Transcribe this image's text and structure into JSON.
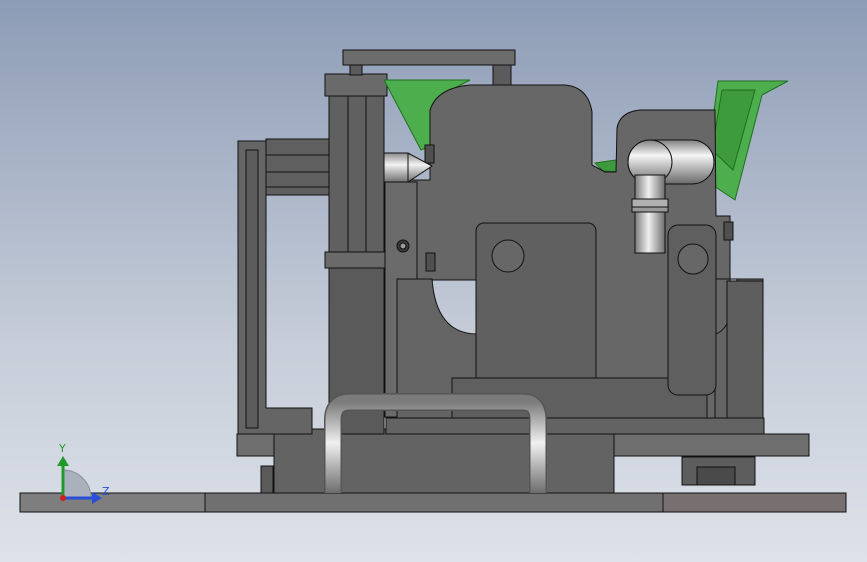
{
  "viewport": {
    "background_top": "#8d9cb6",
    "background_bottom": "#dde2ea"
  },
  "palette": {
    "metal": "#6b6b6b",
    "metal_dark": "#4d4d4d",
    "metal_light": "#8a8a8a",
    "edge": "#111111",
    "green": "#4cae4c",
    "green_dark": "#1f6f1f",
    "chrome": "#c8c8c8"
  },
  "triad": {
    "y_label": "Y",
    "z_label": "Z",
    "y_color": "#1f9a2a",
    "z_color": "#2a4ed8",
    "origin_color": "#d21f1f"
  }
}
